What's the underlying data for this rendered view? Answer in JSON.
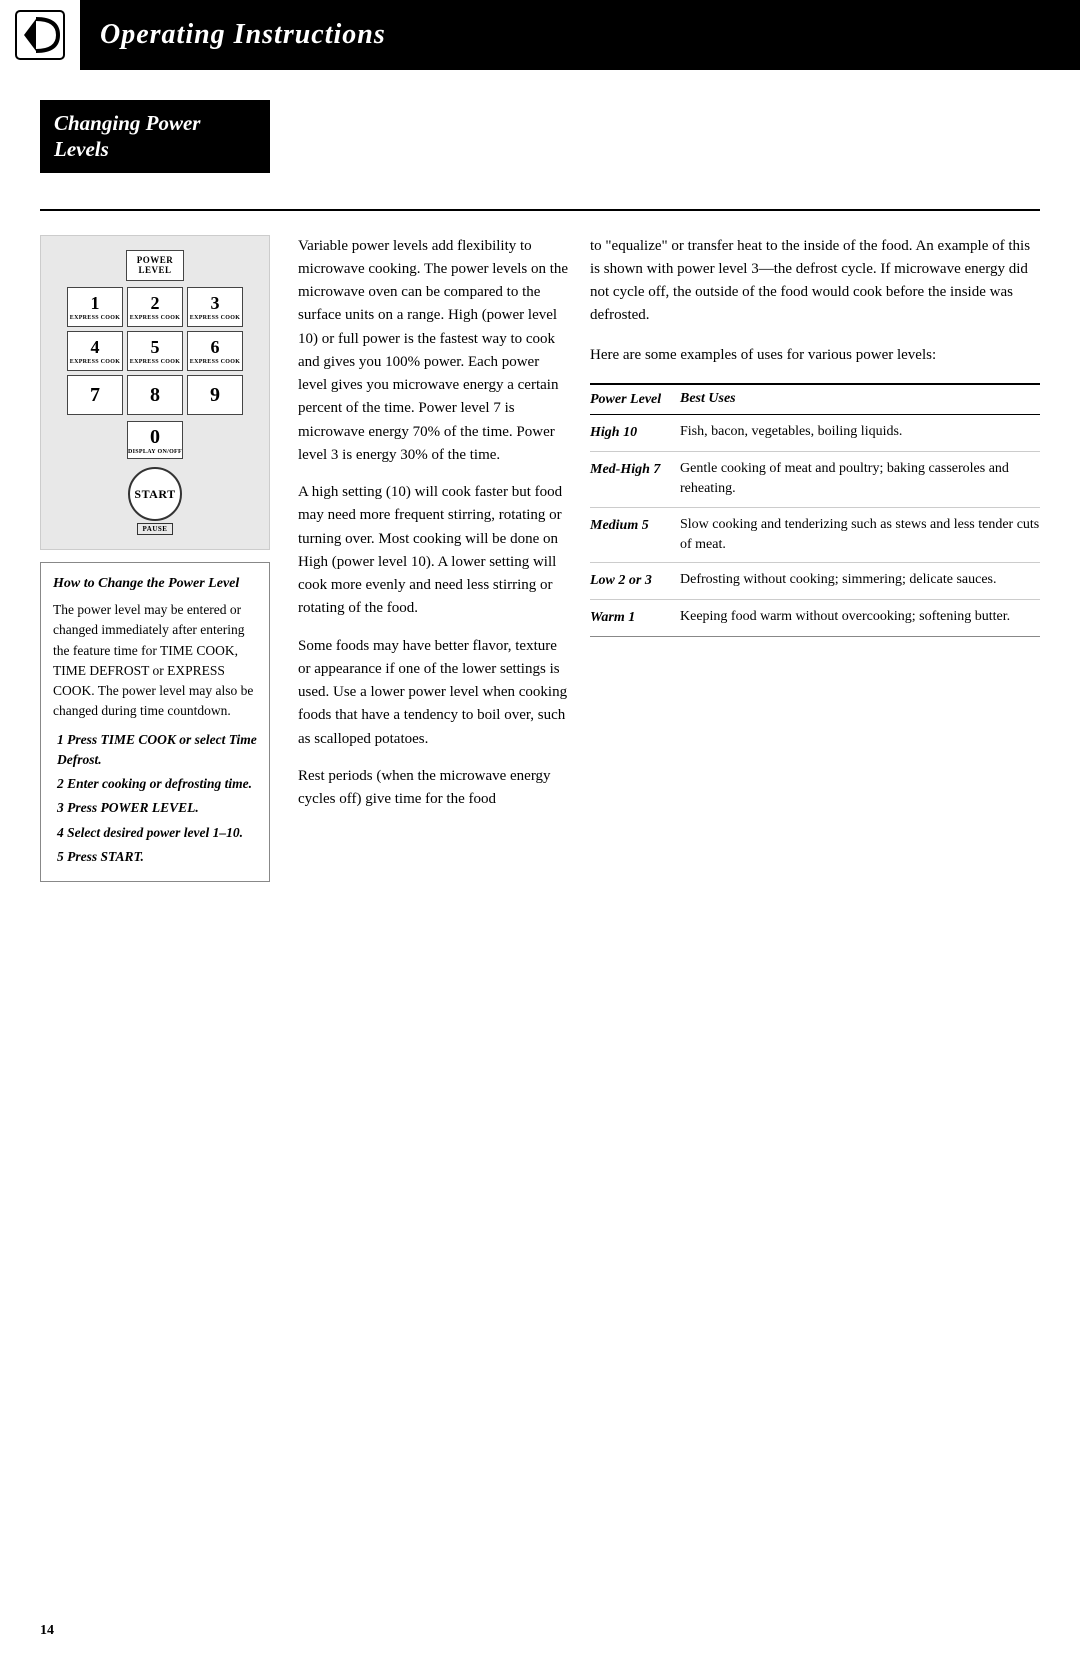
{
  "header": {
    "title": "Operating Instructions"
  },
  "section": {
    "heading_line1": "Changing Power",
    "heading_line2": "Levels"
  },
  "keypad": {
    "power_level_label": "POWER\nLEVEL",
    "keys": [
      {
        "num": "1",
        "sub": "EXPRESS COOK"
      },
      {
        "num": "2",
        "sub": "EXPRESS COOK"
      },
      {
        "num": "3",
        "sub": "EXPRESS COOK"
      },
      {
        "num": "4",
        "sub": "EXPRESS COOK"
      },
      {
        "num": "5",
        "sub": "EXPRESS COOK"
      },
      {
        "num": "6",
        "sub": "EXPRESS COOK"
      },
      {
        "num": "7",
        "sub": ""
      },
      {
        "num": "8",
        "sub": ""
      },
      {
        "num": "9",
        "sub": ""
      }
    ],
    "key0": {
      "num": "0",
      "sub": "DISPLAY ON/OFF"
    },
    "start": "START",
    "pause": "PAUSE"
  },
  "how_to": {
    "title": "How to Change the Power Level",
    "body": "The power level may be entered or changed immediately after entering the feature time for TIME COOK, TIME DEFROST or EXPRESS COOK. The power level may also be changed during time countdown.",
    "steps": [
      "1  Press TIME COOK or select Time Defrost.",
      "2  Enter cooking or defrosting time.",
      "3  Press POWER LEVEL.",
      "4  Select desired power level 1–10.",
      "5  Press START."
    ]
  },
  "middle_text": {
    "para1": "Variable power levels add flexibility to microwave cooking. The power levels on the microwave oven can be compared to the surface units on a range. High (power level 10) or full power is the fastest way to cook and gives you 100% power. Each power level gives you microwave energy a certain percent of the time. Power level 7 is microwave energy 70% of the time. Power level 3 is energy 30% of the time.",
    "para2": "A high setting (10) will cook faster but food may need more frequent stirring, rotating or turning over. Most cooking will be done on High (power level 10). A lower setting will cook more evenly and need less stirring or rotating of the food.",
    "para3": "Some foods may have better flavor, texture or appearance if one of the lower settings is used. Use a lower power level when cooking foods that have a tendency to boil over, such as scalloped potatoes.",
    "para4": "Rest periods (when the microwave energy cycles off) give time for the food"
  },
  "right_text": {
    "intro1": "to \"equalize\" or transfer heat to the inside of the food. An example of this is shown with power level 3—the defrost cycle. If microwave energy did not cycle off, the outside of the food would cook before the inside was defrosted.",
    "intro2": "Here are some examples of uses for various power levels:"
  },
  "table": {
    "col1_header": "Power Level",
    "col2_header": "Best Uses",
    "rows": [
      {
        "level": "High 10",
        "uses": "Fish, bacon, vegetables, boiling liquids."
      },
      {
        "level": "Med-High 7",
        "uses": "Gentle cooking of meat and poultry; baking casseroles and reheating."
      },
      {
        "level": "Medium 5",
        "uses": "Slow cooking and tenderizing such as stews and less tender cuts of meat."
      },
      {
        "level": "Low 2 or 3",
        "uses": "Defrosting without cooking; simmering; delicate sauces."
      },
      {
        "level": "Warm 1",
        "uses": "Keeping food warm without overcooking; softening butter."
      }
    ]
  },
  "page_number": "14"
}
